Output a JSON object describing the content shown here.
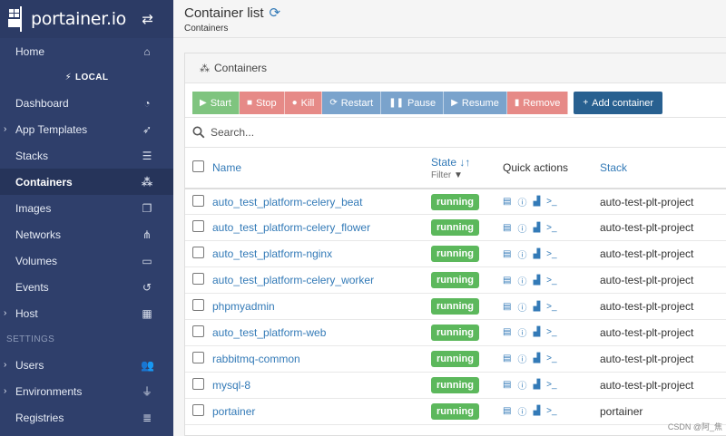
{
  "brand": {
    "name": "portainer.io"
  },
  "sidebar": {
    "home": "Home",
    "endpoint": "LOCAL",
    "items": [
      {
        "label": "Dashboard",
        "icon": "dashboard-icon"
      },
      {
        "label": "App Templates",
        "icon": "rocket-icon"
      },
      {
        "label": "Stacks",
        "icon": "list-icon"
      },
      {
        "label": "Containers",
        "icon": "cubes-icon"
      },
      {
        "label": "Images",
        "icon": "clone-icon"
      },
      {
        "label": "Networks",
        "icon": "sitemap-icon"
      },
      {
        "label": "Volumes",
        "icon": "hdd-icon"
      },
      {
        "label": "Events",
        "icon": "history-icon"
      },
      {
        "label": "Host",
        "icon": "grid-icon"
      }
    ],
    "settings_label": "SETTINGS",
    "settings_items": [
      {
        "label": "Users",
        "icon": "users-icon"
      },
      {
        "label": "Environments",
        "icon": "plug-icon"
      },
      {
        "label": "Registries",
        "icon": "database-icon"
      }
    ]
  },
  "header": {
    "title": "Container list",
    "breadcrumb": "Containers"
  },
  "panel": {
    "title": "Containers"
  },
  "actions": {
    "start": "Start",
    "stop": "Stop",
    "kill": "Kill",
    "restart": "Restart",
    "pause": "Pause",
    "resume": "Resume",
    "remove": "Remove",
    "add": "Add container"
  },
  "search": {
    "placeholder": "Search..."
  },
  "table": {
    "headers": {
      "name": "Name",
      "state": "State",
      "filter": "Filter",
      "quick_actions": "Quick actions",
      "stack": "Stack"
    },
    "rows": [
      {
        "name": "auto_test_platform-celery_beat",
        "state": "running",
        "stack": "auto-test-plt-project"
      },
      {
        "name": "auto_test_platform-celery_flower",
        "state": "running",
        "stack": "auto-test-plt-project"
      },
      {
        "name": "auto_test_platform-nginx",
        "state": "running",
        "stack": "auto-test-plt-project"
      },
      {
        "name": "auto_test_platform-celery_worker",
        "state": "running",
        "stack": "auto-test-plt-project"
      },
      {
        "name": "phpmyadmin",
        "state": "running",
        "stack": "auto-test-plt-project"
      },
      {
        "name": "auto_test_platform-web",
        "state": "running",
        "stack": "auto-test-plt-project"
      },
      {
        "name": "rabbitmq-common",
        "state": "running",
        "stack": "auto-test-plt-project"
      },
      {
        "name": "mysql-8",
        "state": "running",
        "stack": "auto-test-plt-project"
      },
      {
        "name": "portainer",
        "state": "running",
        "stack": "portainer"
      }
    ]
  },
  "watermark": "CSDN @阿_焦",
  "colors": {
    "sidebar": "#2f3f6b",
    "running": "#5cb85c",
    "primary": "#286090",
    "link": "#337ab7"
  }
}
